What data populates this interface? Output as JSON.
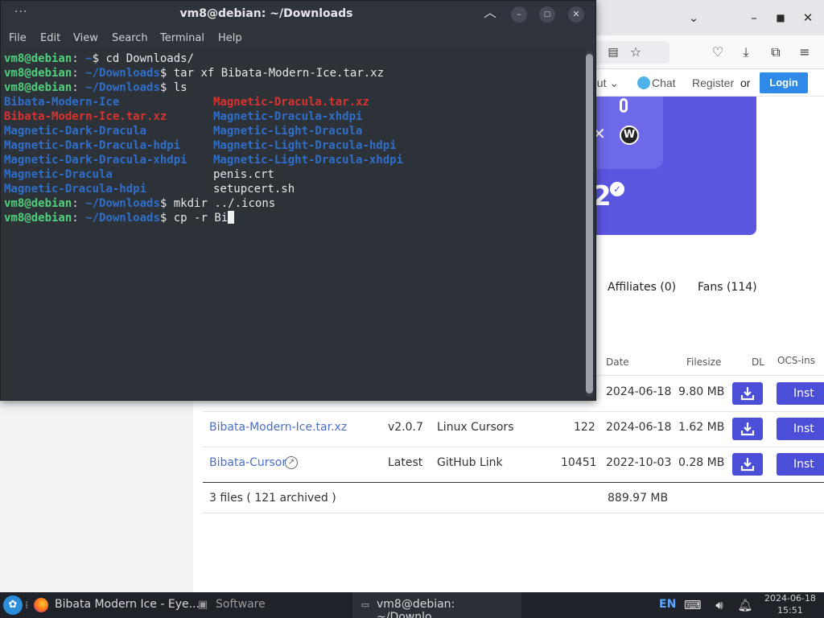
{
  "terminal": {
    "title": "vm8@debian: ~/Downloads",
    "menu": [
      "File",
      "Edit",
      "View",
      "Search",
      "Terminal",
      "Help"
    ],
    "prompt_user": "vm8@debian",
    "prompt_sep": ":",
    "prompt_path_home": " ~",
    "prompt_path_dl": " ~/Downloads",
    "prompt_dollar": "$ ",
    "cmd1": "cd Downloads/",
    "cmd2": "tar xf Bibata-Modern-Ice.tar.xz",
    "cmd3": "ls",
    "ls_col1": [
      "Bibata-Modern-Ice",
      "Bibata-Modern-Ice.tar.xz",
      "Magnetic-Dark-Dracula",
      "Magnetic-Dark-Dracula-hdpi",
      "Magnetic-Dark-Dracula-xhdpi",
      "Magnetic-Dracula",
      "Magnetic-Dracula-hdpi"
    ],
    "ls_col2": [
      "Magnetic-Dracula.tar.xz",
      "Magnetic-Dracula-xhdpi",
      "Magnetic-Light-Dracula",
      "Magnetic-Light-Dracula-hdpi",
      "Magnetic-Light-Dracula-xhdpi",
      "penis.crt",
      "setupcert.sh"
    ],
    "cmd4": "mkdir ../.icons",
    "cmd5": "cp -r Bi"
  },
  "browser": {
    "site_nav": {
      "about": "out ⌄",
      "chat": "Chat",
      "register": "Register",
      "or": "or",
      "login": "Login"
    },
    "tabs": [
      "Affiliates (0)",
      "Fans (114)"
    ],
    "table": {
      "headers": {
        "date": "Date",
        "filesize": "Filesize",
        "dl": "DL",
        "ocs": "OCS-ins"
      },
      "rows": [
        {
          "name": "",
          "version": "",
          "type": "",
          "downloads": "",
          "date": "2024-06-18",
          "size": "9.80 MB",
          "install": "Inst"
        },
        {
          "name": "Bibata-Modern-Ice.tar.xz",
          "version": "v2.0.7",
          "type": "Linux Cursors",
          "downloads": "122",
          "date": "2024-06-18",
          "size": "1.62 MB",
          "install": "Inst"
        },
        {
          "name": "Bibata-Cursor",
          "version": "Latest",
          "type": "GitHub Link",
          "downloads": "10451",
          "date": "2022-10-03",
          "size": "0.28 MB",
          "install": "Inst"
        }
      ],
      "footer": {
        "files": "3 files ( 121 archived )",
        "total": "889.97 MB"
      }
    }
  },
  "taskbar": {
    "firefox_window": "Bibata Modern Ice - Eye...",
    "software": "Software",
    "terminal_window": "vm8@debian: ~/Downlo...",
    "lang": "EN",
    "date": "2024-06-18",
    "time": "15:51"
  }
}
